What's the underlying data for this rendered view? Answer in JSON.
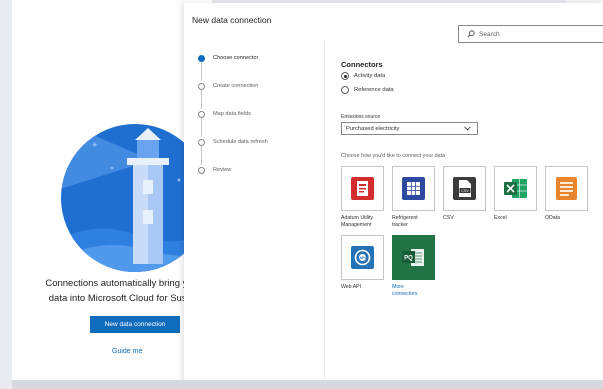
{
  "background": {
    "message_line1": "Connections automatically bring yo",
    "message_line2": "data into Microsoft Cloud for Sust",
    "primary_button": "New data connection",
    "link": "Guide me"
  },
  "panel": {
    "title": "New data connection",
    "search_placeholder": "Search",
    "steps": [
      {
        "label": "Choose connector",
        "active": true
      },
      {
        "label": "Create connection",
        "active": false
      },
      {
        "label": "Map data fields",
        "active": false
      },
      {
        "label": "Schedule data refresh",
        "active": false
      },
      {
        "label": "Review",
        "active": false
      }
    ],
    "connectors_heading": "Connectors",
    "radio_options": [
      {
        "label": "Activity data",
        "checked": true
      },
      {
        "label": "Reference data",
        "checked": false
      }
    ],
    "emissions_label": "Emissions source",
    "emissions_value": "Purchased electricity",
    "helper_text": "Choose how you'd like to connect your data",
    "tiles": [
      {
        "label": "Adatum Utility Management",
        "line1": "Adatum Utility",
        "line2": "Management",
        "icon": "utility-doc-icon",
        "color": "#d42d2d"
      },
      {
        "label": "Refrigerent tracker",
        "line1": "Refrigerent",
        "line2": "tracker",
        "icon": "spreadsheet-icon",
        "color": "#2e4a9e"
      },
      {
        "label": "CSV",
        "line1": "CSV",
        "line2": "",
        "icon": "csv-file-icon",
        "color": "#3b3a39"
      },
      {
        "label": "Excel",
        "line1": "Excel",
        "line2": "",
        "icon": "excel-icon",
        "color": "#1d7044"
      },
      {
        "label": "OData",
        "line1": "OData",
        "line2": "",
        "icon": "odata-icon",
        "color": "#e8842c"
      },
      {
        "label": "Web API",
        "line1": "Web API",
        "line2": "",
        "icon": "web-api-icon",
        "color": "#2572b7"
      },
      {
        "label": "More connectors",
        "line1": "More",
        "line2": "connectors",
        "icon": "power-query-icon",
        "color": "#217346"
      }
    ]
  }
}
